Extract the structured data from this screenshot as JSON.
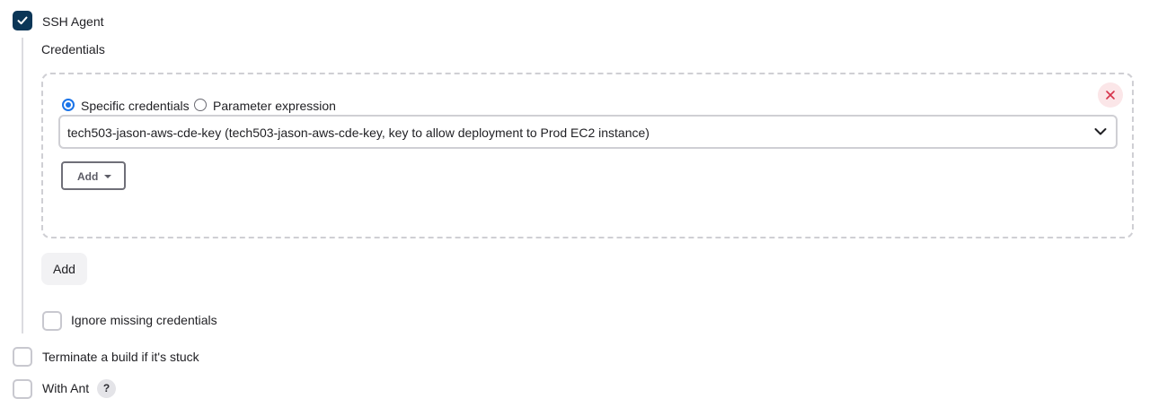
{
  "ssh_agent": {
    "label": "SSH Agent",
    "checked": true,
    "credentials_heading": "Credentials",
    "credential_source": {
      "options": [
        "Specific credentials",
        "Parameter expression"
      ],
      "selected": "Specific credentials"
    },
    "credential_select_value": "tech503-jason-aws-cde-key (tech503-jason-aws-cde-key, key to allow deployment to Prod EC2 instance)",
    "add_dropdown_label": "Add",
    "add_button_label": "Add",
    "ignore_missing_label": "Ignore missing credentials",
    "ignore_missing_checked": false
  },
  "terminate_stuck": {
    "label": "Terminate a build if it's stuck",
    "checked": false
  },
  "with_ant": {
    "label": "With Ant",
    "checked": false,
    "help_icon_text": "?"
  },
  "colors": {
    "checked_checkbox": "#0b3657",
    "radio_selected": "#1a73e8",
    "close_button_bg": "#fbe6e8",
    "close_icon": "#d6334b"
  }
}
